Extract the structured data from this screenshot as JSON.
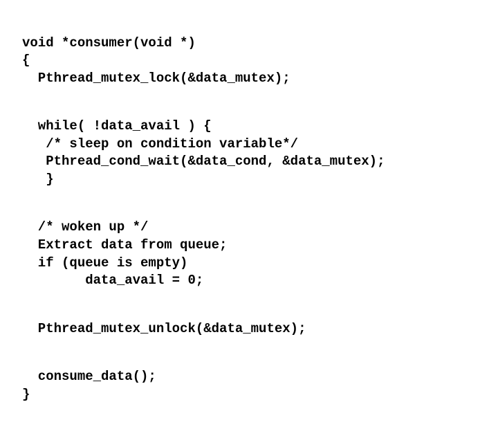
{
  "code": {
    "p1": {
      "l1": "void *consumer(void *)",
      "l2": "{",
      "l3": "  Pthread_mutex_lock(&data_mutex);"
    },
    "p2": {
      "l1": "  while( !data_avail ) {",
      "l2": "   /* sleep on condition variable*/",
      "l3": "   Pthread_cond_wait(&data_cond, &data_mutex);",
      "l4": "   }"
    },
    "p3": {
      "l1": "  /* woken up */",
      "l2": "  Extract data from queue;",
      "l3": "  if (queue is empty)",
      "l4": "        data_avail = 0;"
    },
    "p4": {
      "l1": "  Pthread_mutex_unlock(&data_mutex);"
    },
    "p5": {
      "l1": "  consume_data();",
      "l2": "}"
    }
  }
}
